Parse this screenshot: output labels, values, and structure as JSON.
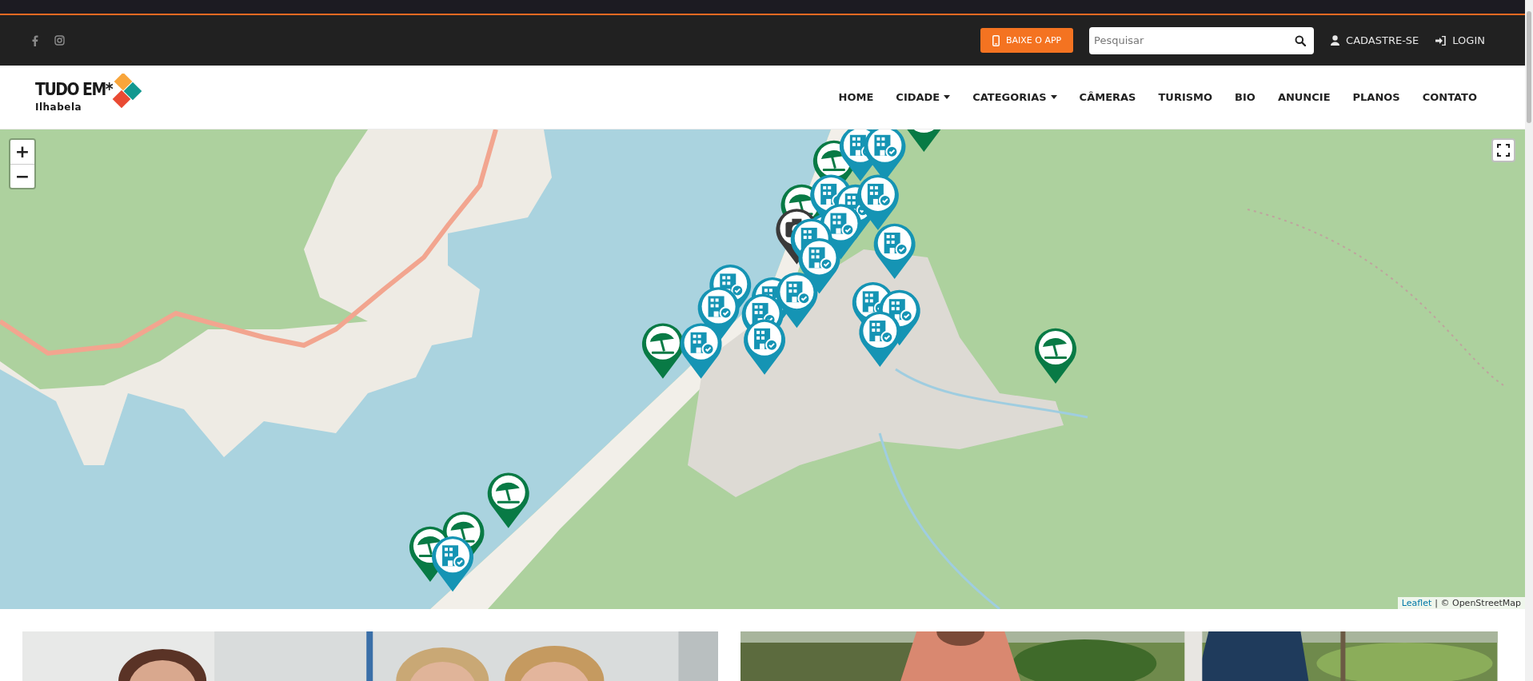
{
  "topbar": {
    "app_button": "BAIXE O APP",
    "search": {
      "placeholder": "Pesquisar"
    },
    "links": [
      {
        "kind": "register",
        "label": "CADASTRE-SE"
      },
      {
        "kind": "login",
        "label": "LOGIN"
      }
    ]
  },
  "logo": {
    "title": "TUDO EM*",
    "subtitle": "Ilhabela"
  },
  "nav": [
    {
      "label": "HOME",
      "dropdown": false
    },
    {
      "label": "CIDADE",
      "dropdown": true
    },
    {
      "label": "CATEGORIAS",
      "dropdown": true
    },
    {
      "label": "CÂMERAS",
      "dropdown": false
    },
    {
      "label": "TURISMO",
      "dropdown": false
    },
    {
      "label": "BIO",
      "dropdown": false
    },
    {
      "label": "ANUNCIE",
      "dropdown": false
    },
    {
      "label": "PLANOS",
      "dropdown": false
    },
    {
      "label": "CONTATO",
      "dropdown": false
    }
  ],
  "map": {
    "zoom_in": "+",
    "zoom_out": "−",
    "attribution": {
      "link": "Leaflet",
      "text": "| © OpenStreetMap"
    }
  }
}
